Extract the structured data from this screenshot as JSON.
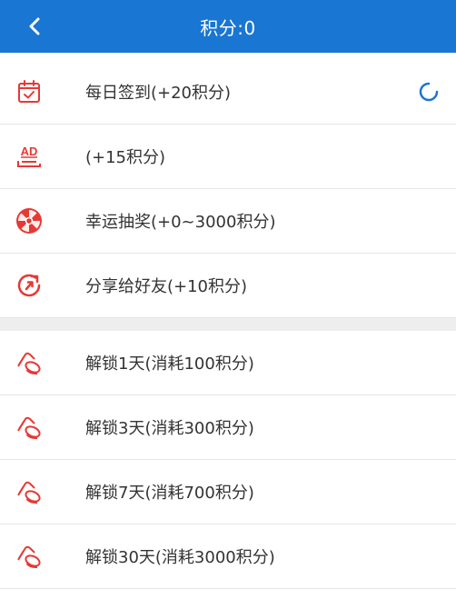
{
  "header": {
    "title": "积分:0",
    "back_icon": "chevron-left-icon",
    "bg_color": "#1976d2"
  },
  "earn": [
    {
      "label": "每日签到(+20积分)",
      "icon": "calendar-check-icon",
      "loading": true
    },
    {
      "label": "(+15积分)",
      "icon": "ad-icon"
    },
    {
      "label": "幸运抽奖(+0~3000积分)",
      "icon": "lucky-wheel-icon"
    },
    {
      "label": "分享给好友(+10积分)",
      "icon": "share-icon"
    }
  ],
  "unlock": [
    {
      "label": "解锁1天(消耗100积分)",
      "icon": "coins-icon"
    },
    {
      "label": "解锁3天(消耗300积分)",
      "icon": "coins-icon"
    },
    {
      "label": "解锁7天(消耗700积分)",
      "icon": "coins-icon"
    },
    {
      "label": "解锁30天(消耗3000积分)",
      "icon": "coins-icon"
    }
  ],
  "colors": {
    "icon_red": "#e53935",
    "spinner_blue": "#1976d2",
    "divider": "#e6e6e6",
    "section_gap": "#eeeeee"
  }
}
